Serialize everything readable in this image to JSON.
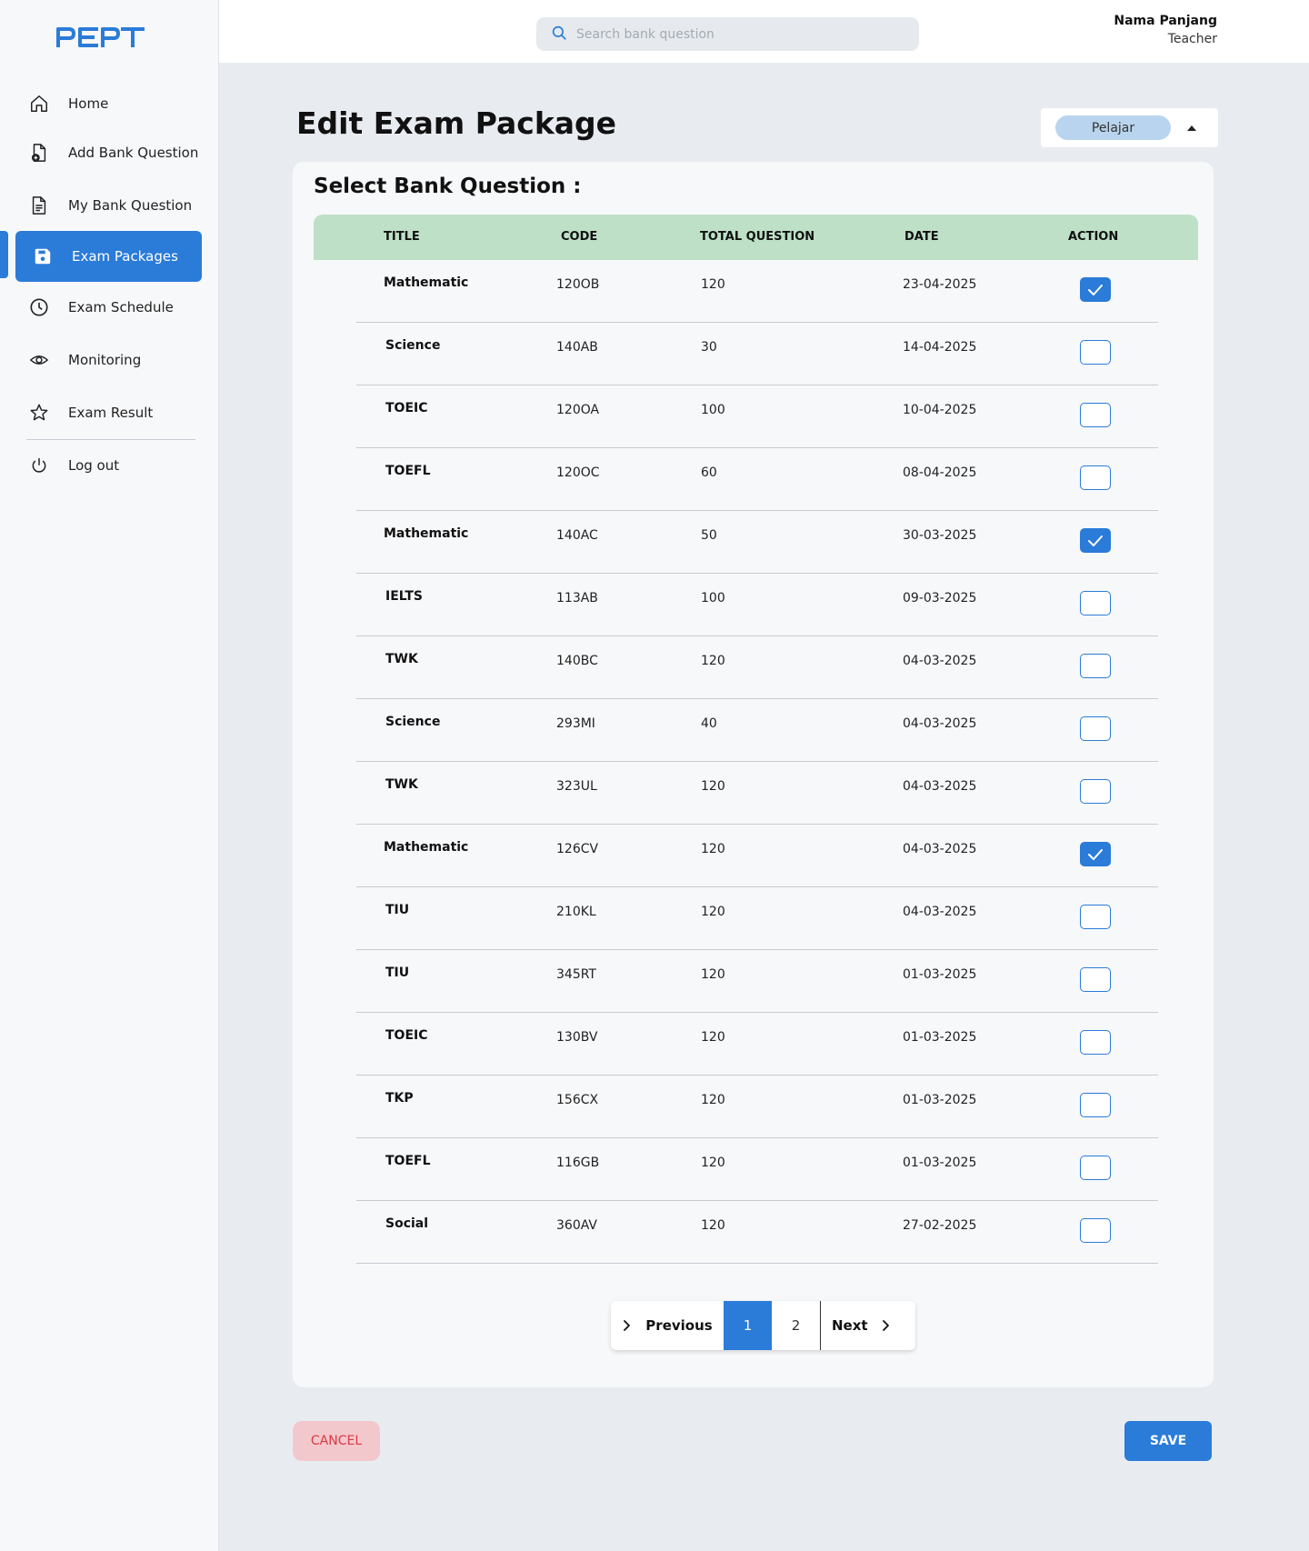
{
  "app": {
    "logo_text": "PEPT",
    "accent_color": "#2b7bd8"
  },
  "sidebar": {
    "items": [
      {
        "label": "Home",
        "icon": "home-icon",
        "active": false
      },
      {
        "label": "Add Bank Question",
        "icon": "file-add-icon",
        "active": false
      },
      {
        "label": "My Bank Question",
        "icon": "document-icon",
        "active": false
      },
      {
        "label": "Exam Packages",
        "icon": "save-icon",
        "active": true
      },
      {
        "label": "Exam Schedule",
        "icon": "clock-icon",
        "active": false
      },
      {
        "label": "Monitoring",
        "icon": "eye-icon",
        "active": false
      },
      {
        "label": "Exam Result",
        "icon": "star-icon",
        "active": false
      },
      {
        "label": "Log out",
        "icon": "power-icon",
        "active": false
      }
    ]
  },
  "header": {
    "search_placeholder": "Search bank question",
    "user_name": "Nama Panjang",
    "user_role": "Teacher"
  },
  "main": {
    "page_title": "Edit Exam Package",
    "role_select_value": "Pelajar",
    "section_title": "Select Bank Question :"
  },
  "table": {
    "columns": [
      "TITLE",
      "CODE",
      "TOTAL QUESTION",
      "DATE",
      "ACTION"
    ],
    "header_color": "#bde0c6",
    "rows": [
      {
        "title": "Mathematic",
        "code": "120OB",
        "total": "120",
        "date": "23-04-2025",
        "checked": true
      },
      {
        "title": "Science",
        "code": "140AB",
        "total": "30",
        "date": "14-04-2025",
        "checked": false
      },
      {
        "title": "TOEIC",
        "code": "120OA",
        "total": "100",
        "date": "10-04-2025",
        "checked": false
      },
      {
        "title": "TOEFL",
        "code": "120OC",
        "total": "60",
        "date": "08-04-2025",
        "checked": false
      },
      {
        "title": "Mathematic",
        "code": "140AC",
        "total": "50",
        "date": "30-03-2025",
        "checked": true
      },
      {
        "title": "IELTS",
        "code": "113AB",
        "total": "100",
        "date": "09-03-2025",
        "checked": false
      },
      {
        "title": "TWK",
        "code": "140BC",
        "total": "120",
        "date": "04-03-2025",
        "checked": false
      },
      {
        "title": "Science",
        "code": "293MI",
        "total": "40",
        "date": "04-03-2025",
        "checked": false
      },
      {
        "title": "TWK",
        "code": "323UL",
        "total": "120",
        "date": "04-03-2025",
        "checked": false
      },
      {
        "title": "Mathematic",
        "code": "126CV",
        "total": "120",
        "date": "04-03-2025",
        "checked": true
      },
      {
        "title": "TIU",
        "code": "210KL",
        "total": "120",
        "date": "04-03-2025",
        "checked": false
      },
      {
        "title": "TIU",
        "code": "345RT",
        "total": "120",
        "date": "01-03-2025",
        "checked": false
      },
      {
        "title": "TOEIC",
        "code": "130BV",
        "total": "120",
        "date": "01-03-2025",
        "checked": false
      },
      {
        "title": "TKP",
        "code": "156CX",
        "total": "120",
        "date": "01-03-2025",
        "checked": false
      },
      {
        "title": "TOEFL",
        "code": "116GB",
        "total": "120",
        "date": "01-03-2025",
        "checked": false
      },
      {
        "title": "Social",
        "code": "360AV",
        "total": "120",
        "date": "27-02-2025",
        "checked": false
      }
    ]
  },
  "pagination": {
    "previous_label": "Previous",
    "pages": [
      "1",
      "2"
    ],
    "current_page": "1",
    "next_label": "Next"
  },
  "actions": {
    "cancel_label": "CANCEL",
    "save_label": "SAVE",
    "cancel_color": "#d93a46"
  }
}
